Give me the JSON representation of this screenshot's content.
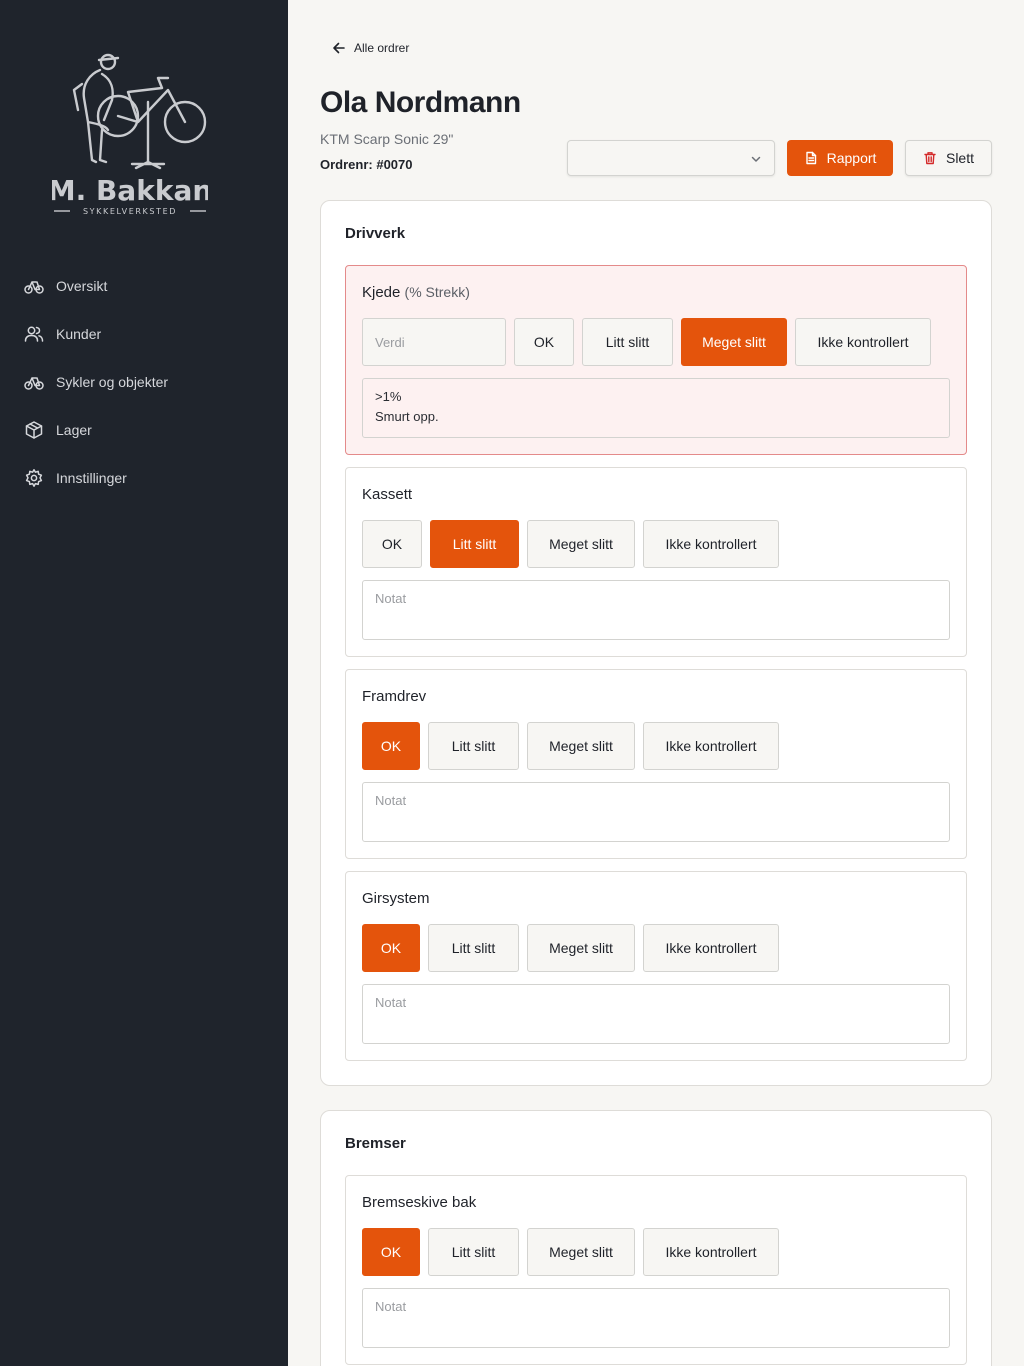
{
  "brand": {
    "name": "M. Bakkan",
    "tagline": "SYKKELVERKSTED"
  },
  "sidebar": {
    "items": [
      {
        "label": "Oversikt",
        "icon": "bike-icon"
      },
      {
        "label": "Kunder",
        "icon": "users-icon"
      },
      {
        "label": "Sykler og objekter",
        "icon": "bike-icon"
      },
      {
        "label": "Lager",
        "icon": "box-icon"
      },
      {
        "label": "Innstillinger",
        "icon": "gear-icon"
      }
    ]
  },
  "header": {
    "back_label": "Alle ordrer",
    "customer_name": "Ola Nordmann",
    "bike": "KTM Scarp Sonic 29\"",
    "order_number": "Ordrenr: #0070",
    "status_select_value": "",
    "report_label": "Rapport",
    "delete_label": "Slett"
  },
  "colors": {
    "accent": "#e4540c",
    "sidebar_bg": "#1f242c",
    "alert_bg": "#fdf1f1",
    "alert_border": "#e48a8a"
  },
  "sections": [
    {
      "title": "Drivverk",
      "items": [
        {
          "title": "Kjede",
          "unit": "(% Strekk)",
          "value_placeholder": "Verdi",
          "options": [
            "OK",
            "Litt slitt",
            "Meget slitt",
            "Ikke kontrollert"
          ],
          "selected": "Meget slitt",
          "note_line1": ">1%",
          "note_line2": "Smurt opp."
        },
        {
          "title": "Kassett",
          "options": [
            "OK",
            "Litt slitt",
            "Meget slitt",
            "Ikke kontrollert"
          ],
          "selected": "Litt slitt",
          "note_placeholder": "Notat"
        },
        {
          "title": "Framdrev",
          "options": [
            "OK",
            "Litt slitt",
            "Meget slitt",
            "Ikke kontrollert"
          ],
          "selected": "OK",
          "note_placeholder": "Notat"
        },
        {
          "title": "Girsystem",
          "options": [
            "OK",
            "Litt slitt",
            "Meget slitt",
            "Ikke kontrollert"
          ],
          "selected": "OK",
          "note_placeholder": "Notat"
        }
      ]
    },
    {
      "title": "Bremser",
      "items": [
        {
          "title": "Bremseskive bak",
          "options": [
            "OK",
            "Litt slitt",
            "Meget slitt",
            "Ikke kontrollert"
          ],
          "selected": "OK",
          "note_placeholder": "Notat"
        }
      ]
    }
  ]
}
